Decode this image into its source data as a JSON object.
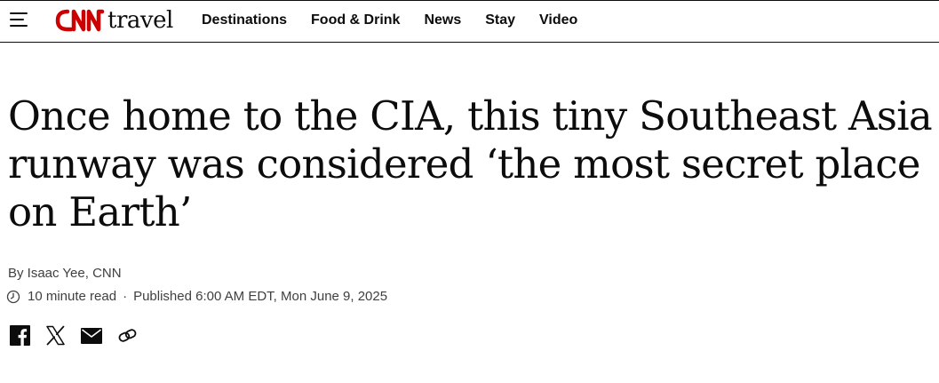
{
  "header": {
    "logo_text": "travel",
    "nav": [
      "Destinations",
      "Food & Drink",
      "News",
      "Stay",
      "Video"
    ]
  },
  "article": {
    "headline": "Once home to the CIA, this tiny Southeast Asia runway was considered ‘the most secret place on Earth’",
    "byline": "By Isaac Yee, CNN",
    "read_time": "10 minute read",
    "separator": "·",
    "published": "Published 6:00 AM EDT, Mon June 9, 2025"
  },
  "icons": {
    "menu": "hamburger-menu-icon",
    "clock": "clock-icon",
    "share": [
      "facebook-icon",
      "x-icon",
      "email-icon",
      "link-icon"
    ]
  },
  "colors": {
    "brand_red": "#cc0000",
    "text": "#0c0c0c",
    "meta_text": "#404040"
  }
}
